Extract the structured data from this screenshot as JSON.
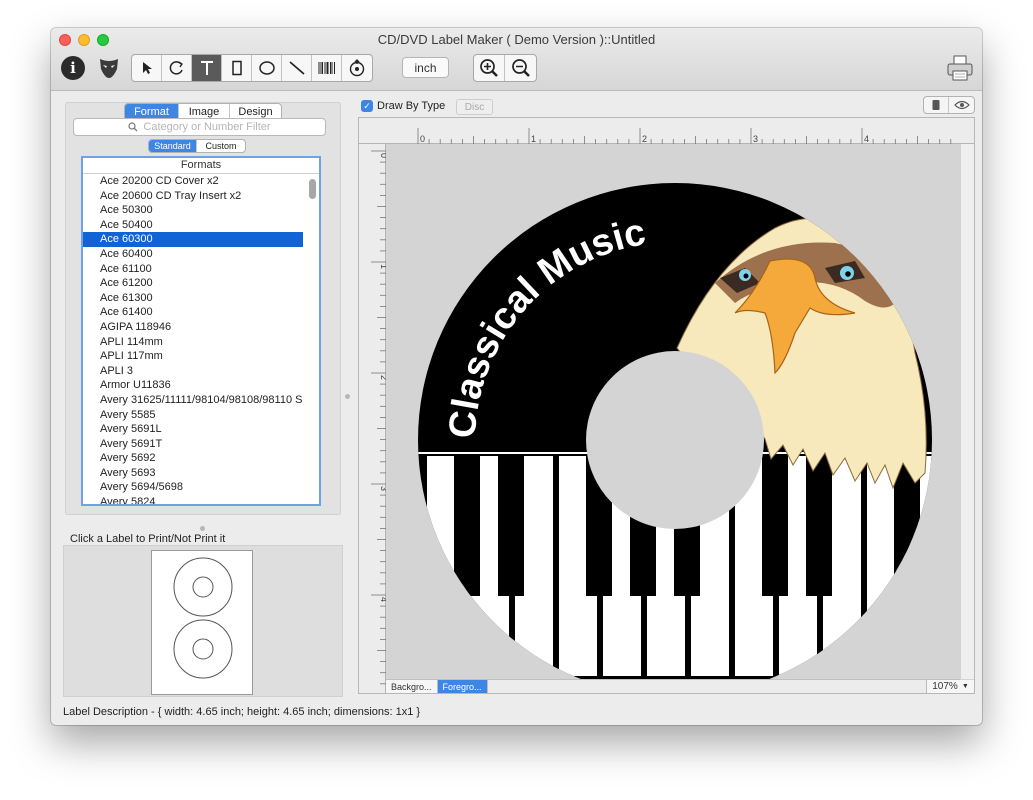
{
  "window": {
    "title": "CD/DVD Label Maker ( Demo Version )::Untitled"
  },
  "toolbar": {
    "unit_label": "inch",
    "tools": [
      "select-arrow",
      "rotate",
      "text",
      "rectangle",
      "ellipse",
      "line",
      "barcode",
      "image-import"
    ],
    "active_tool": "text"
  },
  "left_panel": {
    "tabs": [
      "Format",
      "Image",
      "Design"
    ],
    "active_tab": "Format",
    "search_placeholder": "Category or Number Filter",
    "subtabs": [
      "Standard",
      "Custom"
    ],
    "active_subtab": "Standard",
    "list_header": "Formats",
    "selected_format": "Ace 60300",
    "formats": [
      "Ace 20200 CD Cover x2",
      "Ace 20600 CD Tray Insert x2",
      "Ace 50300",
      "Ace 50400",
      "Ace 60300",
      "Ace 60400",
      "Ace 61100",
      "Ace 61200",
      "Ace 61300",
      "Ace 61400",
      "AGIPA 118946",
      "APLI 114mm",
      "APLI 117mm",
      "APLI 3",
      "Armor U11836",
      "Avery 31625/11111/98104/98108/98110 S",
      "Avery 5585",
      "Avery 5691L",
      "Avery 5691T",
      "Avery 5692",
      "Avery 5693",
      "Avery 5694/5698",
      "Avery 5824"
    ],
    "print_hint": "Click a Label to Print/Not Print it"
  },
  "editor": {
    "draw_by_type_label": "Draw By Type",
    "draw_by_type_checked": true,
    "disc_button": "Disc",
    "ruler_h_labels": [
      "0",
      "1",
      "2",
      "3",
      "4"
    ],
    "ruler_v_labels": [
      "0",
      "1",
      "2",
      "3",
      "4"
    ],
    "layer_tabs": [
      "Backgro...",
      "Foregro..."
    ],
    "active_layer": "Foregro...",
    "zoom": "107%",
    "label_title": "Classical Music"
  },
  "status": {
    "description": "Label Description - { width: 4.65 inch; height: 4.65 inch; dimensions: 1x1 }"
  },
  "colors": {
    "accent": "#3d86e4",
    "selection": "#1263d6",
    "disc_black": "#000000",
    "eagle_cream": "#f8e9bd",
    "beak": "#f5a93a"
  }
}
